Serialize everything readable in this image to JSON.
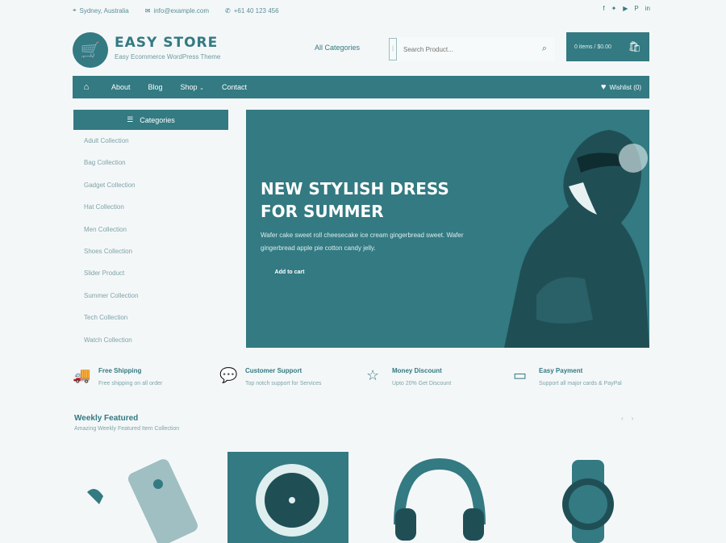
{
  "topbar": {
    "location": "Sydney, Australia",
    "email": "info@example.com",
    "phone": "+61 40 123 456"
  },
  "social_icons": [
    "facebook-icon",
    "twitter-icon",
    "youtube-icon",
    "pinterest-icon",
    "linkedin-icon"
  ],
  "header": {
    "title": "EASY STORE",
    "tagline": "Easy Ecommerce WordPress Theme",
    "category_select": "All Categories",
    "search_placeholder": "Search Product...",
    "cart_label": "0 items / $0.00"
  },
  "nav": {
    "items": [
      "About",
      "Blog",
      "Shop",
      "Contact"
    ],
    "wishlist": "Wishlist (0)"
  },
  "categories": {
    "heading": "Categories",
    "items": [
      "Adult Collection",
      "Bag Collection",
      "Gadget Collection",
      "Hat Collection",
      "Men Collection",
      "Shoes Collection",
      "Slider Product",
      "Summer Collection",
      "Tech Collection",
      "Watch Collection"
    ]
  },
  "banner": {
    "heading": "NEW STYLISH DRESS FOR SUMMER",
    "text": "Wafer cake sweet roll cheesecake ice cream gingerbread sweet. Wafer gingerbread apple pie cotton candy jelly.",
    "button": "Add to cart"
  },
  "features": [
    {
      "icon": "truck-icon",
      "title": "Free Shipping",
      "subtitle": "Free shipping on all order"
    },
    {
      "icon": "chat-icon",
      "title": "Customer Support",
      "subtitle": "Top notch support for Services"
    },
    {
      "icon": "star-icon",
      "title": "Money Discount",
      "subtitle": "Upto 20% Get Discount"
    },
    {
      "icon": "card-icon",
      "title": "Easy Payment",
      "subtitle": "Support all major cards & PayPal"
    }
  ],
  "weekly": {
    "title": "Weekly Featured",
    "subtitle": "Amazing Weekly Featured Item Collection"
  },
  "colors": {
    "primary": "#337a82",
    "background": "#f4f7f8"
  }
}
